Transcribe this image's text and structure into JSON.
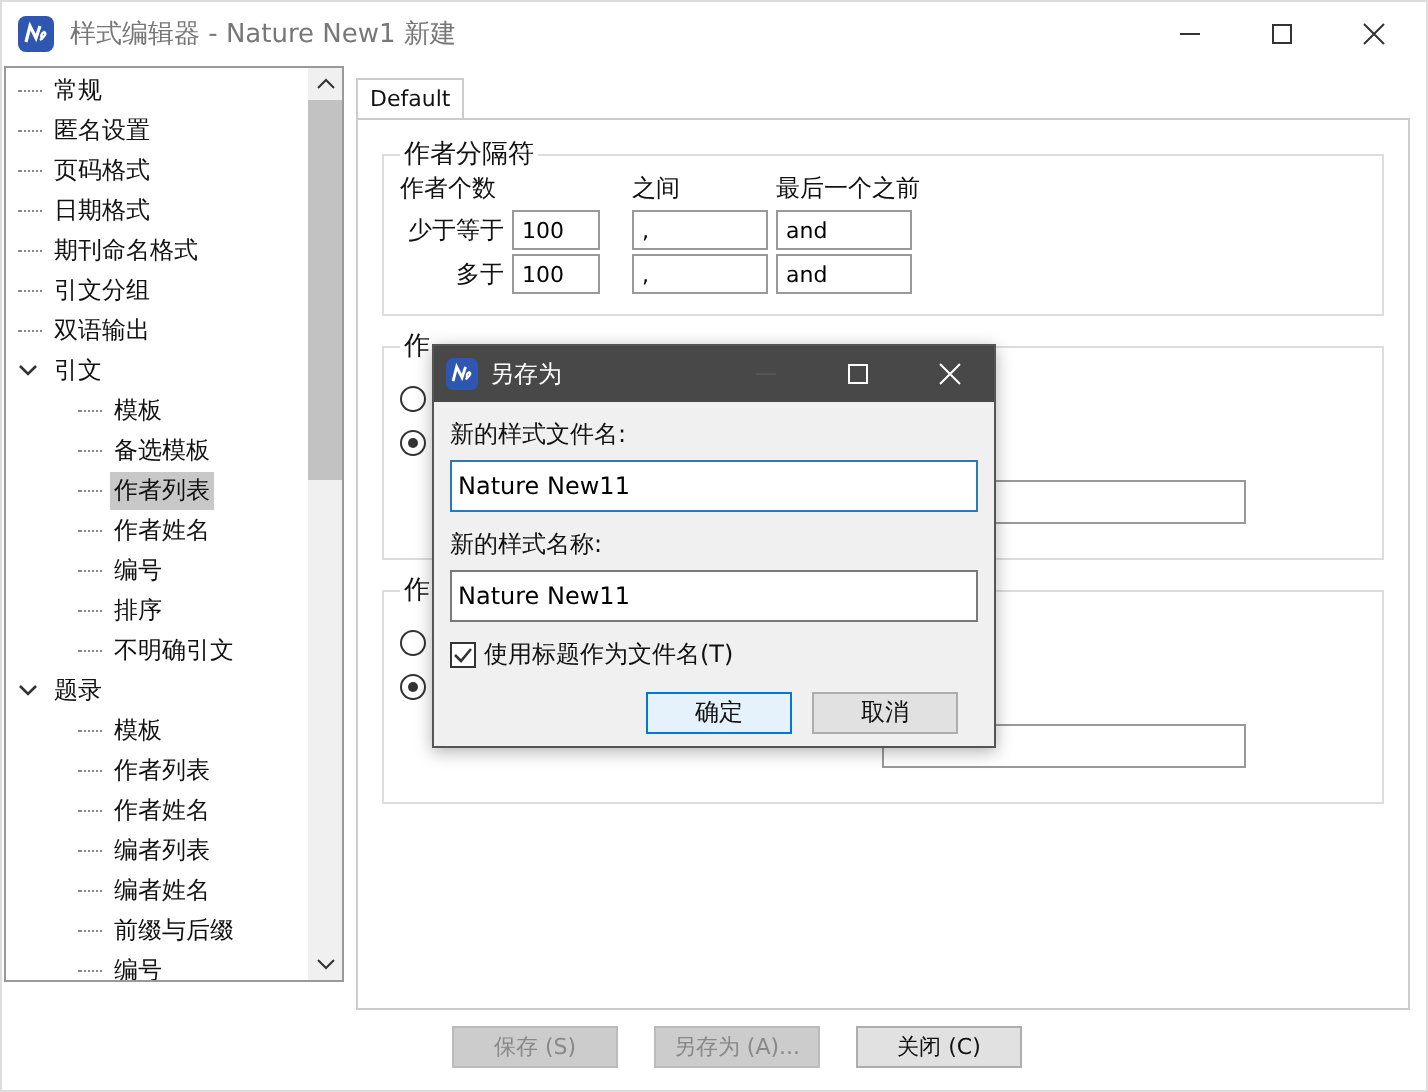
{
  "window": {
    "title": "样式编辑器 - Nature New1  新建"
  },
  "sidebar": {
    "tree": [
      {
        "label": "常规",
        "selected": false
      },
      {
        "label": "匿名设置",
        "selected": false
      },
      {
        "label": "页码格式",
        "selected": false
      },
      {
        "label": "日期格式",
        "selected": false
      },
      {
        "label": "期刊命名格式",
        "selected": false
      },
      {
        "label": "引文分组",
        "selected": false
      },
      {
        "label": "双语输出",
        "selected": false
      },
      {
        "label": "引文",
        "selected": false,
        "expanded": true,
        "children": [
          {
            "label": "模板",
            "selected": false
          },
          {
            "label": "备选模板",
            "selected": false
          },
          {
            "label": "作者列表",
            "selected": true
          },
          {
            "label": "作者姓名",
            "selected": false
          },
          {
            "label": "编号",
            "selected": false
          },
          {
            "label": "排序",
            "selected": false
          },
          {
            "label": "不明确引文",
            "selected": false
          }
        ]
      },
      {
        "label": "题录",
        "selected": false,
        "expanded": true,
        "children": [
          {
            "label": "模板",
            "selected": false
          },
          {
            "label": "作者列表",
            "selected": false
          },
          {
            "label": "作者姓名",
            "selected": false
          },
          {
            "label": "编者列表",
            "selected": false
          },
          {
            "label": "编者姓名",
            "selected": false
          },
          {
            "label": "前缀与后缀",
            "selected": false
          },
          {
            "label": "编号",
            "selected": false
          }
        ]
      }
    ]
  },
  "tabs": [
    {
      "label": "Default",
      "selected": true
    }
  ],
  "separator_group": {
    "title": "作者分隔符",
    "count_heading": "作者个数",
    "between_heading": "之间",
    "last_heading": "最后一个之前",
    "rows": [
      {
        "label": "少于等于",
        "count": "100",
        "between": ",",
        "last": "and"
      },
      {
        "label": "多于",
        "count": "100",
        "between": ",",
        "last": "and"
      }
    ]
  },
  "groups": [
    {
      "title": "作",
      "radios": [
        {
          "selected": false
        },
        {
          "selected": true
        }
      ]
    },
    {
      "title": "作",
      "radios": [
        {
          "selected": false
        },
        {
          "selected": true
        }
      ]
    }
  ],
  "buttons": [
    {
      "label": "保存 (S)",
      "disabled": true
    },
    {
      "label": "另存为 (A)...",
      "disabled": true
    },
    {
      "label": "关闭 (C)",
      "disabled": false
    }
  ],
  "dialog": {
    "title": "另存为",
    "file_label": "新的样式文件名:",
    "file_value": "Nature New11",
    "name_label": "新的样式名称:",
    "name_value": "Nature New11",
    "checkbox": {
      "label": "使用标题作为文件名(T)",
      "checked": true
    },
    "buttons": [
      {
        "label": "确定",
        "default": true
      },
      {
        "label": "取消",
        "default": false
      }
    ]
  }
}
